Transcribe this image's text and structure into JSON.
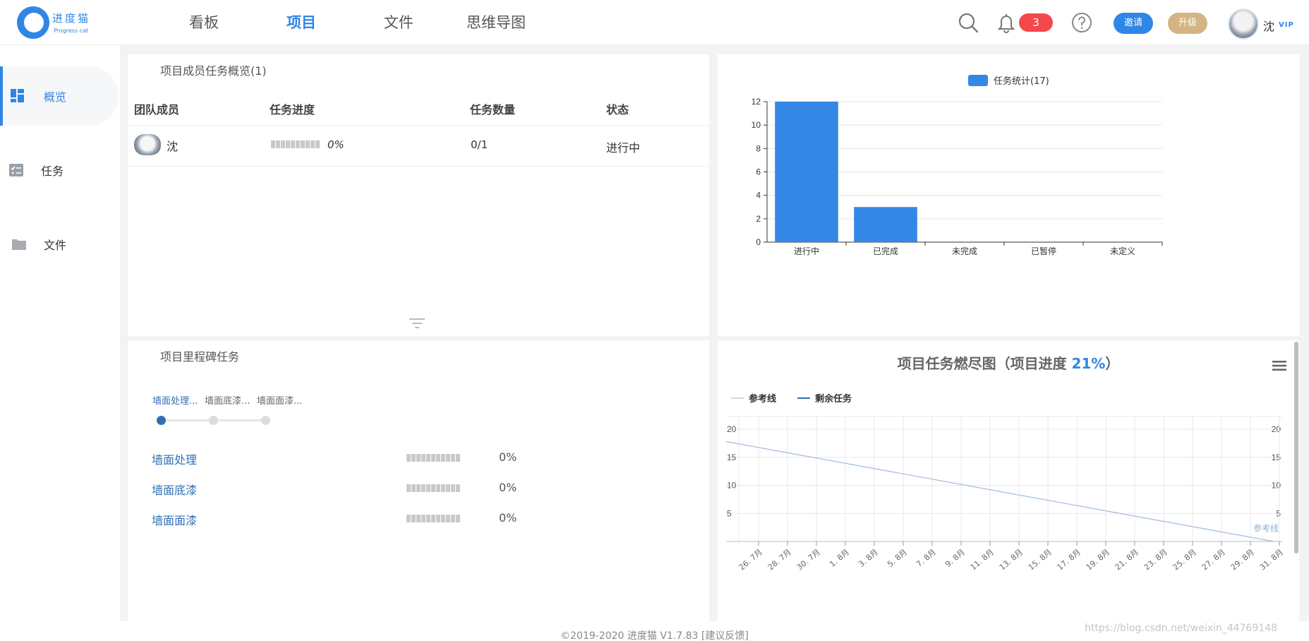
{
  "header": {
    "logo_title": "进度猫",
    "logo_sub": "Progress cat",
    "nav": [
      "看板",
      "项目",
      "文件",
      "思维导图"
    ],
    "active_nav": "项目",
    "notification_count": "3",
    "invite_label": "邀请",
    "upgrade_label": "升级",
    "user_name": "沈",
    "vip_label": "VIP"
  },
  "sidebar": {
    "items": [
      {
        "label": "概览",
        "icon": "dashboard-icon"
      },
      {
        "label": "任务",
        "icon": "task-list-icon"
      },
      {
        "label": "文件",
        "icon": "folder-icon"
      }
    ]
  },
  "members": {
    "title": "项目成员任务概览(1)",
    "columns": [
      "团队成员",
      "任务进度",
      "任务数量",
      "状态"
    ],
    "rows": [
      {
        "name": "沈",
        "progress": "0%",
        "count": "0/1",
        "status": "进行中"
      }
    ]
  },
  "task_chart": {
    "legend": "任务统计(17)",
    "color": "#3487e5"
  },
  "milestones": {
    "title": "项目里程碑任务",
    "steps": [
      "墙面处理...",
      "墙面底漆...",
      "墙面面漆..."
    ],
    "items": [
      {
        "name": "墙面处理",
        "pct": "0%"
      },
      {
        "name": "墙面底漆",
        "pct": "0%"
      },
      {
        "name": "墙面面漆",
        "pct": "0%"
      }
    ]
  },
  "burndown": {
    "title_prefix": "项目任务燃尽图（项目进度 ",
    "progress": "21%",
    "title_suffix": "）",
    "legend_ref": "参考线",
    "legend_remain": "剩余任务",
    "ref_label": "参考线"
  },
  "footer": {
    "text": "©2019-2020 进度猫 V1.7.83  [建议反馈]",
    "watermark": "https://blog.csdn.net/weixin_44769148"
  },
  "chart_data": [
    {
      "type": "bar",
      "categories": [
        "进行中",
        "已完成",
        "未完成",
        "已暂停",
        "未定义"
      ],
      "series": [
        {
          "name": "任务统计(17)",
          "values": [
            12,
            3,
            0,
            0,
            0
          ]
        }
      ],
      "ylim": [
        0,
        12
      ],
      "yticks": [
        0,
        2,
        4,
        6,
        8,
        10,
        12
      ],
      "legend": "top-center",
      "grid": true
    },
    {
      "type": "line",
      "title": "项目任务燃尽图（项目进度 21%）",
      "x": [
        "26. 7月",
        "28. 7月",
        "30. 7月",
        "1. 8月",
        "3. 8月",
        "5. 8月",
        "7. 8月",
        "9. 8月",
        "11. 8月",
        "13. 8月",
        "15. 8月",
        "17. 8月",
        "19. 8月",
        "21. 8月",
        "23. 8月",
        "25. 8月",
        "27. 8月",
        "29. 8月",
        "31. 8月"
      ],
      "series": [
        {
          "name": "参考线",
          "points": [
            [
              "25. 7月",
              17.8
            ],
            [
              "31. 8月",
              0
            ]
          ]
        },
        {
          "name": "剩余任务",
          "points": []
        }
      ],
      "ylim": [
        0,
        20
      ],
      "yticks": [
        5,
        10,
        15,
        20
      ],
      "legend": "top-left",
      "grid": true
    }
  ]
}
